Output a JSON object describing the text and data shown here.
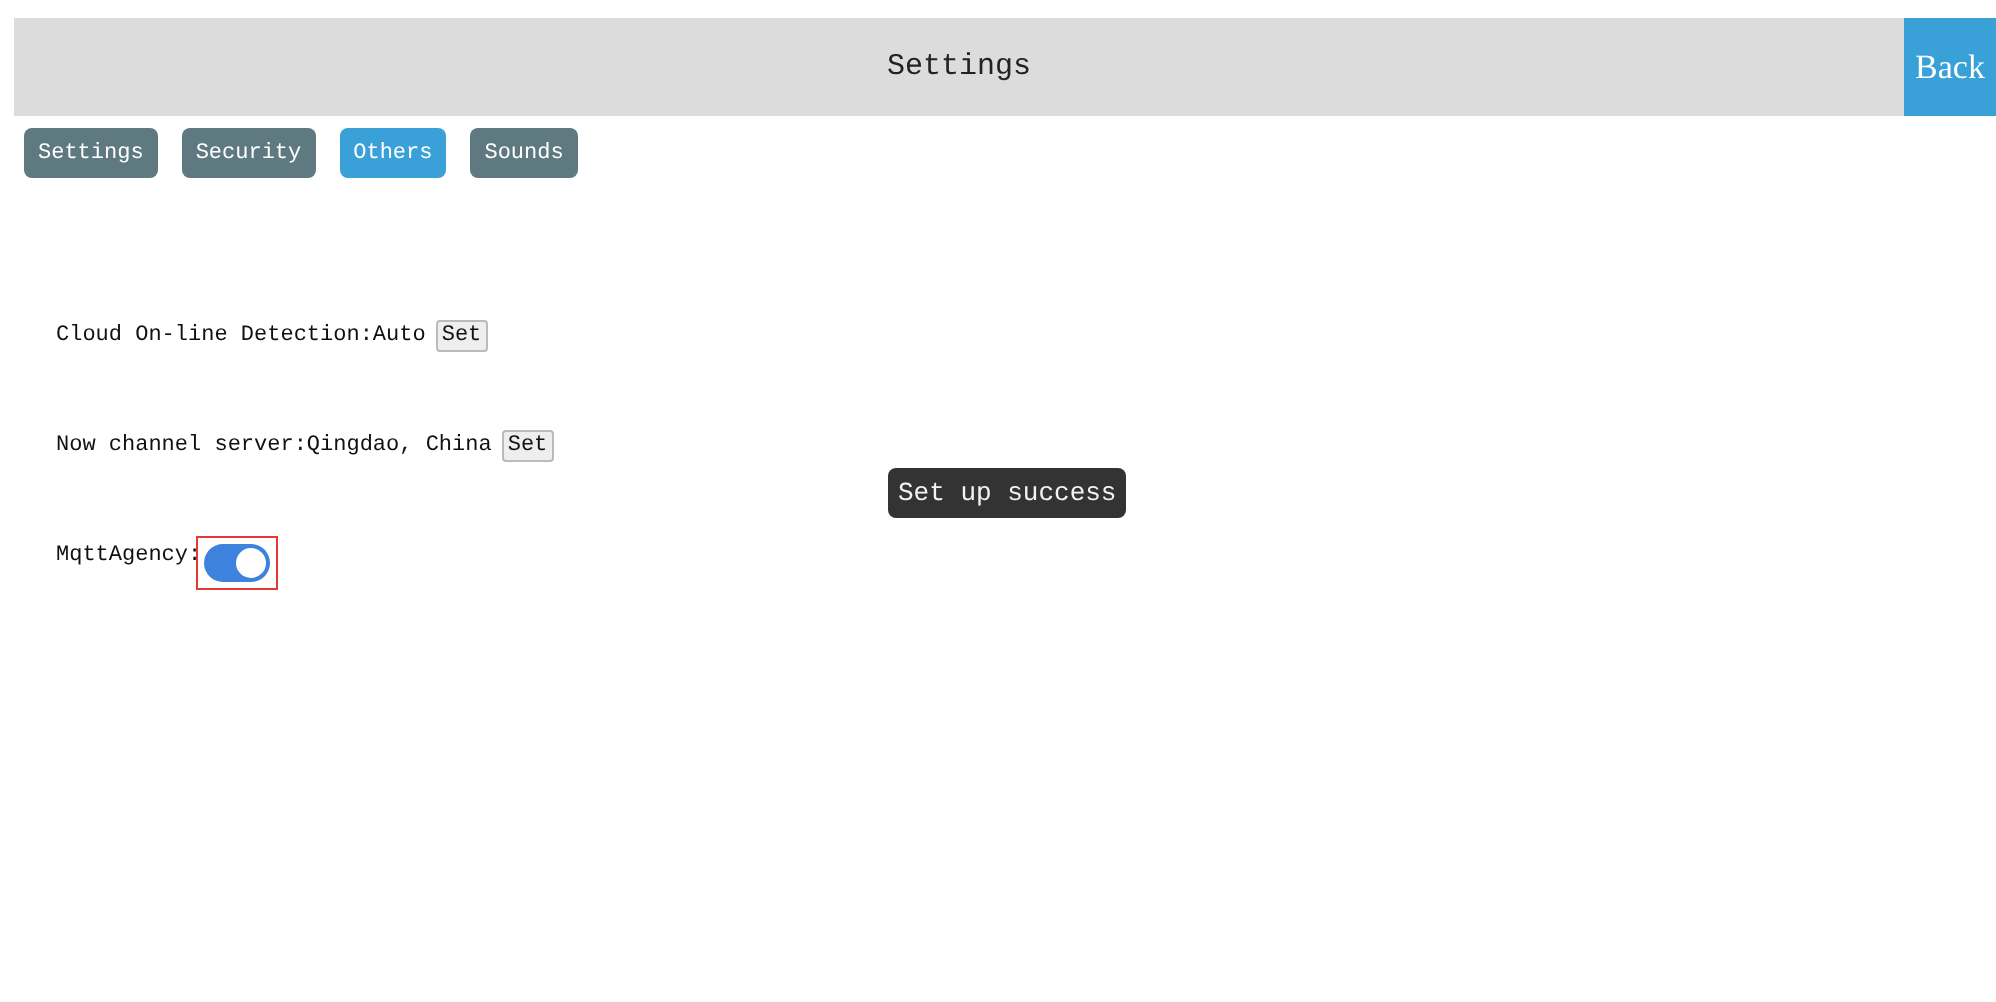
{
  "header": {
    "title": "Settings",
    "back_button": "Back"
  },
  "tabs": [
    {
      "label": "Settings",
      "selected": false
    },
    {
      "label": "Security",
      "selected": false
    },
    {
      "label": "Others",
      "selected": true
    },
    {
      "label": "Sounds",
      "selected": false
    }
  ],
  "rows": [
    {
      "kind": "set",
      "label": "Cloud On-line Detection:Auto",
      "button": "Set"
    },
    {
      "kind": "set",
      "label": "Now channel server:Qingdao, China",
      "button": "Set"
    },
    {
      "kind": "toggle",
      "label": "MqttAgency:",
      "on": true,
      "highlighted": true
    }
  ],
  "toast": "Set up success"
}
